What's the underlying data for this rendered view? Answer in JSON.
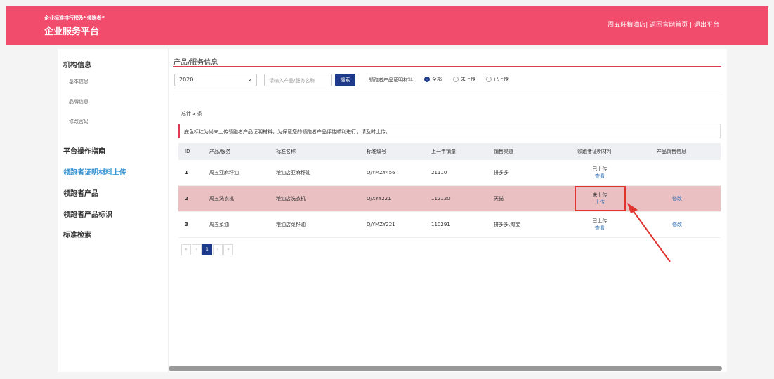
{
  "header": {
    "brand_small": "企业标准排行榜及“领跑者”",
    "brand_title": "企业服务平台",
    "user": "周五旺粮油店",
    "home_link": "返回官网首页",
    "logout_link": "退出平台",
    "separator": "|"
  },
  "sidebar": {
    "org_title": "机构信息",
    "org_items": [
      "基本信息",
      "品牌信息",
      "修改密码"
    ],
    "guide": "平台操作指南",
    "upload": "领跑者证明材料上传",
    "products": "领跑者产品",
    "marks": "领跑者产品标识",
    "search": "标准检索"
  },
  "main": {
    "title": "产品/服务信息",
    "year_select": "2020",
    "search_placeholder": "请输入产品/服务名称",
    "search_button": "搜索",
    "filter_label": "领跑者产品证明材料：",
    "radio_options": [
      "全部",
      "未上传",
      "已上传"
    ],
    "radio_selected": "全部",
    "total_text": "总计 3 条",
    "notice": "底色标红为尚未上传领跑者产品证明材料，为保证您的领跑者产品评估顺利进行，请及时上传。"
  },
  "table": {
    "headers": [
      "ID",
      "产品/服务",
      "标准名称",
      "标准编号",
      "上一年销量",
      "销售渠道",
      "领跑者证明材料",
      "产品销售信息"
    ],
    "rows": [
      {
        "id": "1",
        "product": "周五亚麻籽油",
        "std_name": "粮油店亚麻籽油",
        "std_no": "Q/YMZY456",
        "sales": "21110",
        "channel": "拼多多",
        "status": "已上传",
        "action": "查看",
        "sales_info": ""
      },
      {
        "id": "2",
        "product": "周五洗衣机",
        "std_name": "粮油店洗衣机",
        "std_no": "Q/XYY221",
        "sales": "112120",
        "channel": "天猫",
        "status": "未上传",
        "action": "上传",
        "sales_info": "修改"
      },
      {
        "id": "3",
        "product": "周五菜油",
        "std_name": "粮油店菜籽油",
        "std_no": "Q/YMZY221",
        "sales": "110291",
        "channel": "拼多多,淘宝",
        "status": "已上传",
        "action": "查看",
        "sales_info": "修改"
      }
    ]
  },
  "pager": {
    "first": "«",
    "prev": "‹",
    "current": "1",
    "next": "›",
    "last": "»"
  },
  "colors": {
    "brand": "#f24c6d",
    "accent": "#1e3a8a",
    "highlight_row": "#eac0c2",
    "annotation": "#e0342f"
  }
}
